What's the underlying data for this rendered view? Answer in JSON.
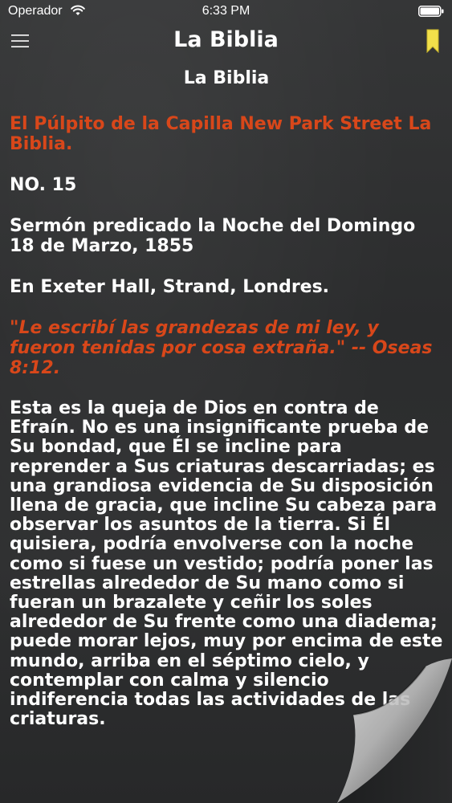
{
  "status_bar": {
    "carrier": "Operador",
    "time": "6:33 PM"
  },
  "nav": {
    "title": "La Biblia"
  },
  "content": {
    "doc_title": "La Biblia",
    "heading": "El Púlpito de la Capilla New Park Street La Biblia.",
    "number": "NO. 15",
    "sermon_info": "Sermón predicado la Noche del Domingo 18 de Marzo, 1855",
    "location": "En Exeter Hall, Strand, Londres.",
    "verse": "\"Le escribí las grandezas de mi ley, y fueron tenidas por cosa extraña.\" -- Oseas 8:12.",
    "body": "Esta es la queja de Dios en contra de Efraín. No es una insignificante prueba de Su bondad, que Él se incline para reprender a Sus criaturas descarriadas; es una grandiosa evidencia de Su disposición llena de gracia, que incline Su cabeza para observar los asuntos de la tierra. Si Él quisiera, podría envolverse con la noche como si fuese un vestido; podría poner las estrellas alrededor de Su mano como si fueran un brazalete y ceñir los soles alrededor de Su frente como una diadema; puede morar lejos, muy por encima de este mundo, arriba en el séptimo cielo, y contemplar con calma y silencio indiferencia todas las actividades de las criaturas."
  },
  "colors": {
    "accent_red": "#d8471a",
    "bookmark_yellow": "#f2e04a",
    "background": "#2e2f30"
  },
  "icons": {
    "menu": "hamburger-menu-icon",
    "bookmark": "bookmark-icon",
    "wifi": "wifi-icon",
    "battery": "battery-icon"
  }
}
